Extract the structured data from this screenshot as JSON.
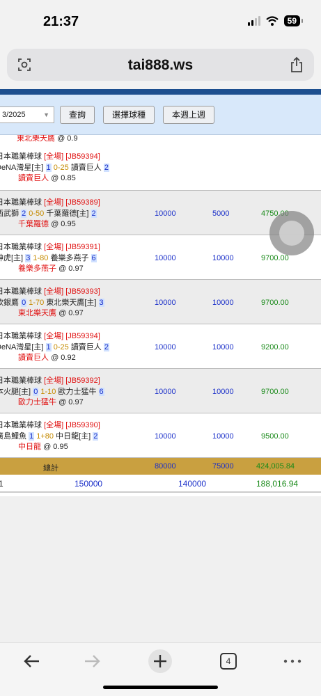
{
  "status": {
    "time": "21:37",
    "battery": "59"
  },
  "browser": {
    "url": "tai888.ws",
    "tab_count": "4"
  },
  "filter": {
    "date_value": "3/2025",
    "query_label": "查詢",
    "sport_label": "選擇球種",
    "last_week_label": "本週上週"
  },
  "partial_row": {
    "pick": "東北樂天鷹",
    "odds": "@ 0.9"
  },
  "bets": [
    {
      "league": "日本職業棒球",
      "type": "[全場]",
      "id": "[JB59394]",
      "team1": "DeNA灣星[主]",
      "s1": "1",
      "hc": "0-25",
      "team2": "讀賣巨人",
      "s2": "2",
      "pick": "讀賣巨人",
      "odds": "@ 0.85",
      "stake": "",
      "valid": "",
      "win": ""
    },
    {
      "league": "日本職業棒球",
      "type": "[全場]",
      "id": "[JB59389]",
      "team1": "西武獅",
      "s1": "2",
      "hc": "0-50",
      "team2": "千葉羅德[主]",
      "s2": "2",
      "pick": "千葉羅德",
      "odds": "@ 0.95",
      "stake": "10000",
      "valid": "5000",
      "win": "4750.00"
    },
    {
      "league": "日本職業棒球",
      "type": "[全場]",
      "id": "[JB59391]",
      "team1": "神虎[主]",
      "s1": "3",
      "hc": "1-80",
      "team2": "養樂多燕子",
      "s2": "6",
      "pick": "養樂多燕子",
      "odds": "@ 0.97",
      "stake": "10000",
      "valid": "10000",
      "win": "9700.00"
    },
    {
      "league": "日本職業棒球",
      "type": "[全場]",
      "id": "[JB59393]",
      "team1": "軟銀鷹",
      "s1": "0",
      "hc": "1-70",
      "team2": "東北樂天鷹[主]",
      "s2": "3",
      "pick": "東北樂天鷹",
      "odds": "@ 0.97",
      "stake": "10000",
      "valid": "10000",
      "win": "9700.00"
    },
    {
      "league": "日本職業棒球",
      "type": "[全場]",
      "id": "[JB59394]",
      "team1": "DeNA灣星[主]",
      "s1": "1",
      "hc": "0-25",
      "team2": "讀賣巨人",
      "s2": "2",
      "pick": "讀賣巨人",
      "odds": "@ 0.92",
      "stake": "10000",
      "valid": "10000",
      "win": "9200.00"
    },
    {
      "league": "日本職業棒球",
      "type": "[全場]",
      "id": "[JB59392]",
      "team1": "本火腿[主]",
      "s1": "0",
      "hc": "1-10",
      "team2": "歐力士猛牛",
      "s2": "6",
      "pick": "歐力士猛牛",
      "odds": "@ 0.97",
      "stake": "10000",
      "valid": "10000",
      "win": "9700.00"
    },
    {
      "league": "日本職業棒球",
      "type": "[全場]",
      "id": "[JB59390]",
      "team1": "廣島鯉魚",
      "s1": "1",
      "hc": "1+80",
      "team2": "中日龍[主]",
      "s2": "2",
      "pick": "中日龍",
      "odds": "@ 0.95",
      "stake": "10000",
      "valid": "10000",
      "win": "9500.00"
    }
  ],
  "total": {
    "label": "總計",
    "stake": "80000",
    "valid": "75000",
    "win": "424,005.84"
  },
  "grand": {
    "label": "1",
    "stake": "150000",
    "valid": "140000",
    "win": "188,016.94"
  },
  "colors": {
    "header_blue": "#1d4f8f",
    "filter_bg": "#d8e8fa",
    "total_gold": "#c9a040",
    "stake_blue": "#1a2fc9",
    "win_green": "#1a8a1a",
    "pick_red": "#e01010"
  },
  "icons": [
    "signal-icon",
    "wifi-icon",
    "battery-icon",
    "reader-icon",
    "share-icon",
    "back-icon",
    "forward-icon",
    "new-tab-icon",
    "tabs-icon",
    "more-icon"
  ]
}
